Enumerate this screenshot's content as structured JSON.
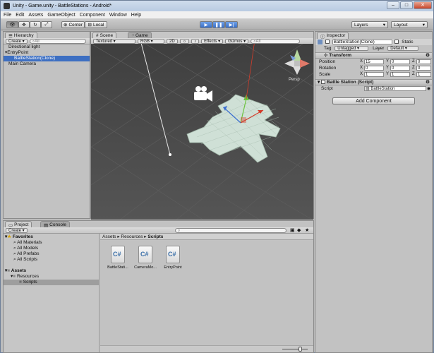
{
  "window": {
    "title": "Unity - Game.unity - BattleStations - Android*"
  },
  "menu": [
    "File",
    "Edit",
    "Assets",
    "GameObject",
    "Component",
    "Window",
    "Help"
  ],
  "toolbar": {
    "pivot_label": "Center",
    "space_label": "Local",
    "layers_label": "Layers",
    "layout_label": "Layout"
  },
  "hierarchy": {
    "tab": "Hierarchy",
    "create_label": "Create",
    "search_placeholder": "All",
    "items": [
      {
        "label": "Directional light",
        "indent": 0,
        "selected": false
      },
      {
        "label": "EntryPoint",
        "indent": 0,
        "selected": false
      },
      {
        "label": "BattleStation(Clone)",
        "indent": 1,
        "selected": true
      },
      {
        "label": "Main Camera",
        "indent": 0,
        "selected": false
      }
    ]
  },
  "scene": {
    "tabs": [
      "Scene",
      "Game"
    ],
    "shading": "Textured",
    "render": "RGB",
    "mode2d": "2D",
    "effects": "Effects",
    "gizmos": "Gizmos",
    "search_placeholder": "All",
    "persp_label": "Persp"
  },
  "inspector": {
    "tab": "Inspector",
    "object_name": "BattleStation(Clone)",
    "static_label": "Static",
    "tag_label": "Tag",
    "tag_value": "Untagged",
    "layer_label": "Layer",
    "layer_value": "Default",
    "transform_title": "Transform",
    "position": {
      "label": "Position",
      "x": "15",
      "y": "0",
      "z": "0"
    },
    "rotation": {
      "label": "Rotation",
      "x": "0",
      "y": "0",
      "z": "0"
    },
    "scale": {
      "label": "Scale",
      "x": "1",
      "y": "1",
      "z": "1"
    },
    "script_component_title": "Battle Station (Script)",
    "script_label": "Script",
    "script_value": "BattleStation",
    "add_component_label": "Add Component",
    "axis_x": "X",
    "axis_y": "Y",
    "axis_z": "Z"
  },
  "project": {
    "tabs": [
      "Project",
      "Console"
    ],
    "create_label": "Create",
    "favorites_label": "Favorites",
    "favorites": [
      "All Materials",
      "All Models",
      "All Prefabs",
      "All Scripts"
    ],
    "assets_label": "Assets",
    "resources_label": "Resources",
    "scripts_label": "Scripts",
    "breadcrumb": [
      "Assets",
      "Resources",
      "Scripts"
    ],
    "files": [
      {
        "name": "BattleStati...",
        "glyph": "C#"
      },
      {
        "name": "CameraMo...",
        "glyph": "C#"
      },
      {
        "name": "EntryPoint",
        "glyph": "C#"
      }
    ]
  }
}
